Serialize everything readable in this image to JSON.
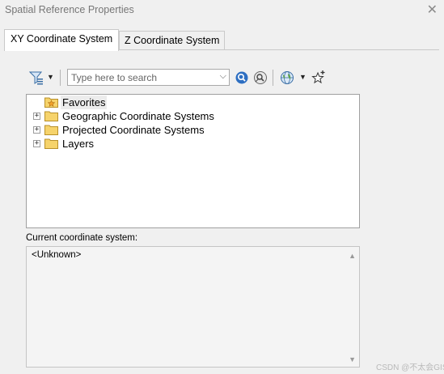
{
  "window": {
    "title": "Spatial Reference Properties"
  },
  "tabs": [
    {
      "label": "XY Coordinate System",
      "active": true
    },
    {
      "label": "Z Coordinate System",
      "active": false
    }
  ],
  "toolbar": {
    "search_placeholder": "Type here to search",
    "icons": [
      "filter-icon",
      "search-icon",
      "clear-search-icon",
      "globe-icon",
      "add-favorite-icon"
    ]
  },
  "tree": {
    "items": [
      {
        "label": "Favorites",
        "expandable": false
      },
      {
        "label": "Geographic Coordinate Systems",
        "expandable": true
      },
      {
        "label": "Projected Coordinate Systems",
        "expandable": true
      },
      {
        "label": "Layers",
        "expandable": true
      }
    ]
  },
  "current": {
    "label": "Current coordinate system:",
    "value": "<Unknown>"
  },
  "watermark": "CSDN @不太会GIS"
}
